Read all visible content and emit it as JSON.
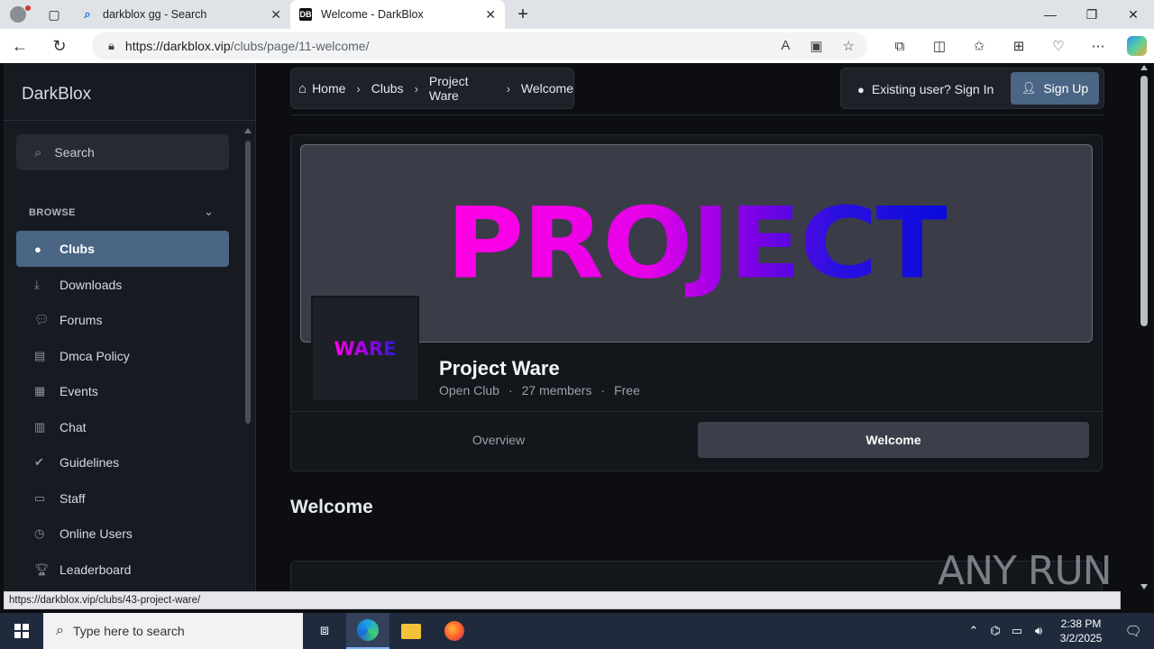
{
  "browser": {
    "tabs": [
      {
        "title": "darkblox gg - Search",
        "favicon": "search-icon"
      },
      {
        "title": "Welcome - DarkBlox",
        "favicon": "DB"
      }
    ],
    "url_host": "https://darkblox.vip",
    "url_path": "/clubs/page/11-welcome/",
    "status_url": "https://darkblox.vip/clubs/43-project-ware/"
  },
  "sidebar": {
    "brand": "DarkBlox",
    "search_placeholder": "Search",
    "section": "BROWSE",
    "items": [
      {
        "label": "Clubs",
        "icon": "user-circle-icon",
        "active": true
      },
      {
        "label": "Downloads",
        "icon": "download-icon"
      },
      {
        "label": "Forums",
        "icon": "chat-bubble-icon"
      },
      {
        "label": "Dmca Policy",
        "icon": "document-icon"
      },
      {
        "label": "Events",
        "icon": "calendar-icon"
      },
      {
        "label": "Chat",
        "icon": "chat-file-icon"
      },
      {
        "label": "Guidelines",
        "icon": "check-circle-icon"
      },
      {
        "label": "Staff",
        "icon": "id-card-icon"
      },
      {
        "label": "Online Users",
        "icon": "clock-icon"
      },
      {
        "label": "Leaderboard",
        "icon": "trophy-icon"
      }
    ]
  },
  "breadcrumb": [
    "Home",
    "Clubs",
    "Project Ware",
    "Welcome"
  ],
  "auth": {
    "signin": "Existing user? Sign In",
    "signup": "Sign Up"
  },
  "club": {
    "cover_text": "PROJECT",
    "avatar_text": "WARE",
    "name": "Project Ware",
    "type": "Open Club",
    "members": "27 members",
    "price": "Free",
    "tabs": [
      "Overview",
      "Welcome"
    ],
    "active_tab": "Welcome"
  },
  "page_title": "Welcome",
  "watermark": "ANY RUN",
  "taskbar": {
    "search_placeholder": "Type here to search",
    "time": "2:38 PM",
    "date": "3/2/2025"
  },
  "colors": {
    "accent": "#4b6584",
    "cover_pink": "#ff00e6",
    "cover_blue": "#0a0adc"
  }
}
